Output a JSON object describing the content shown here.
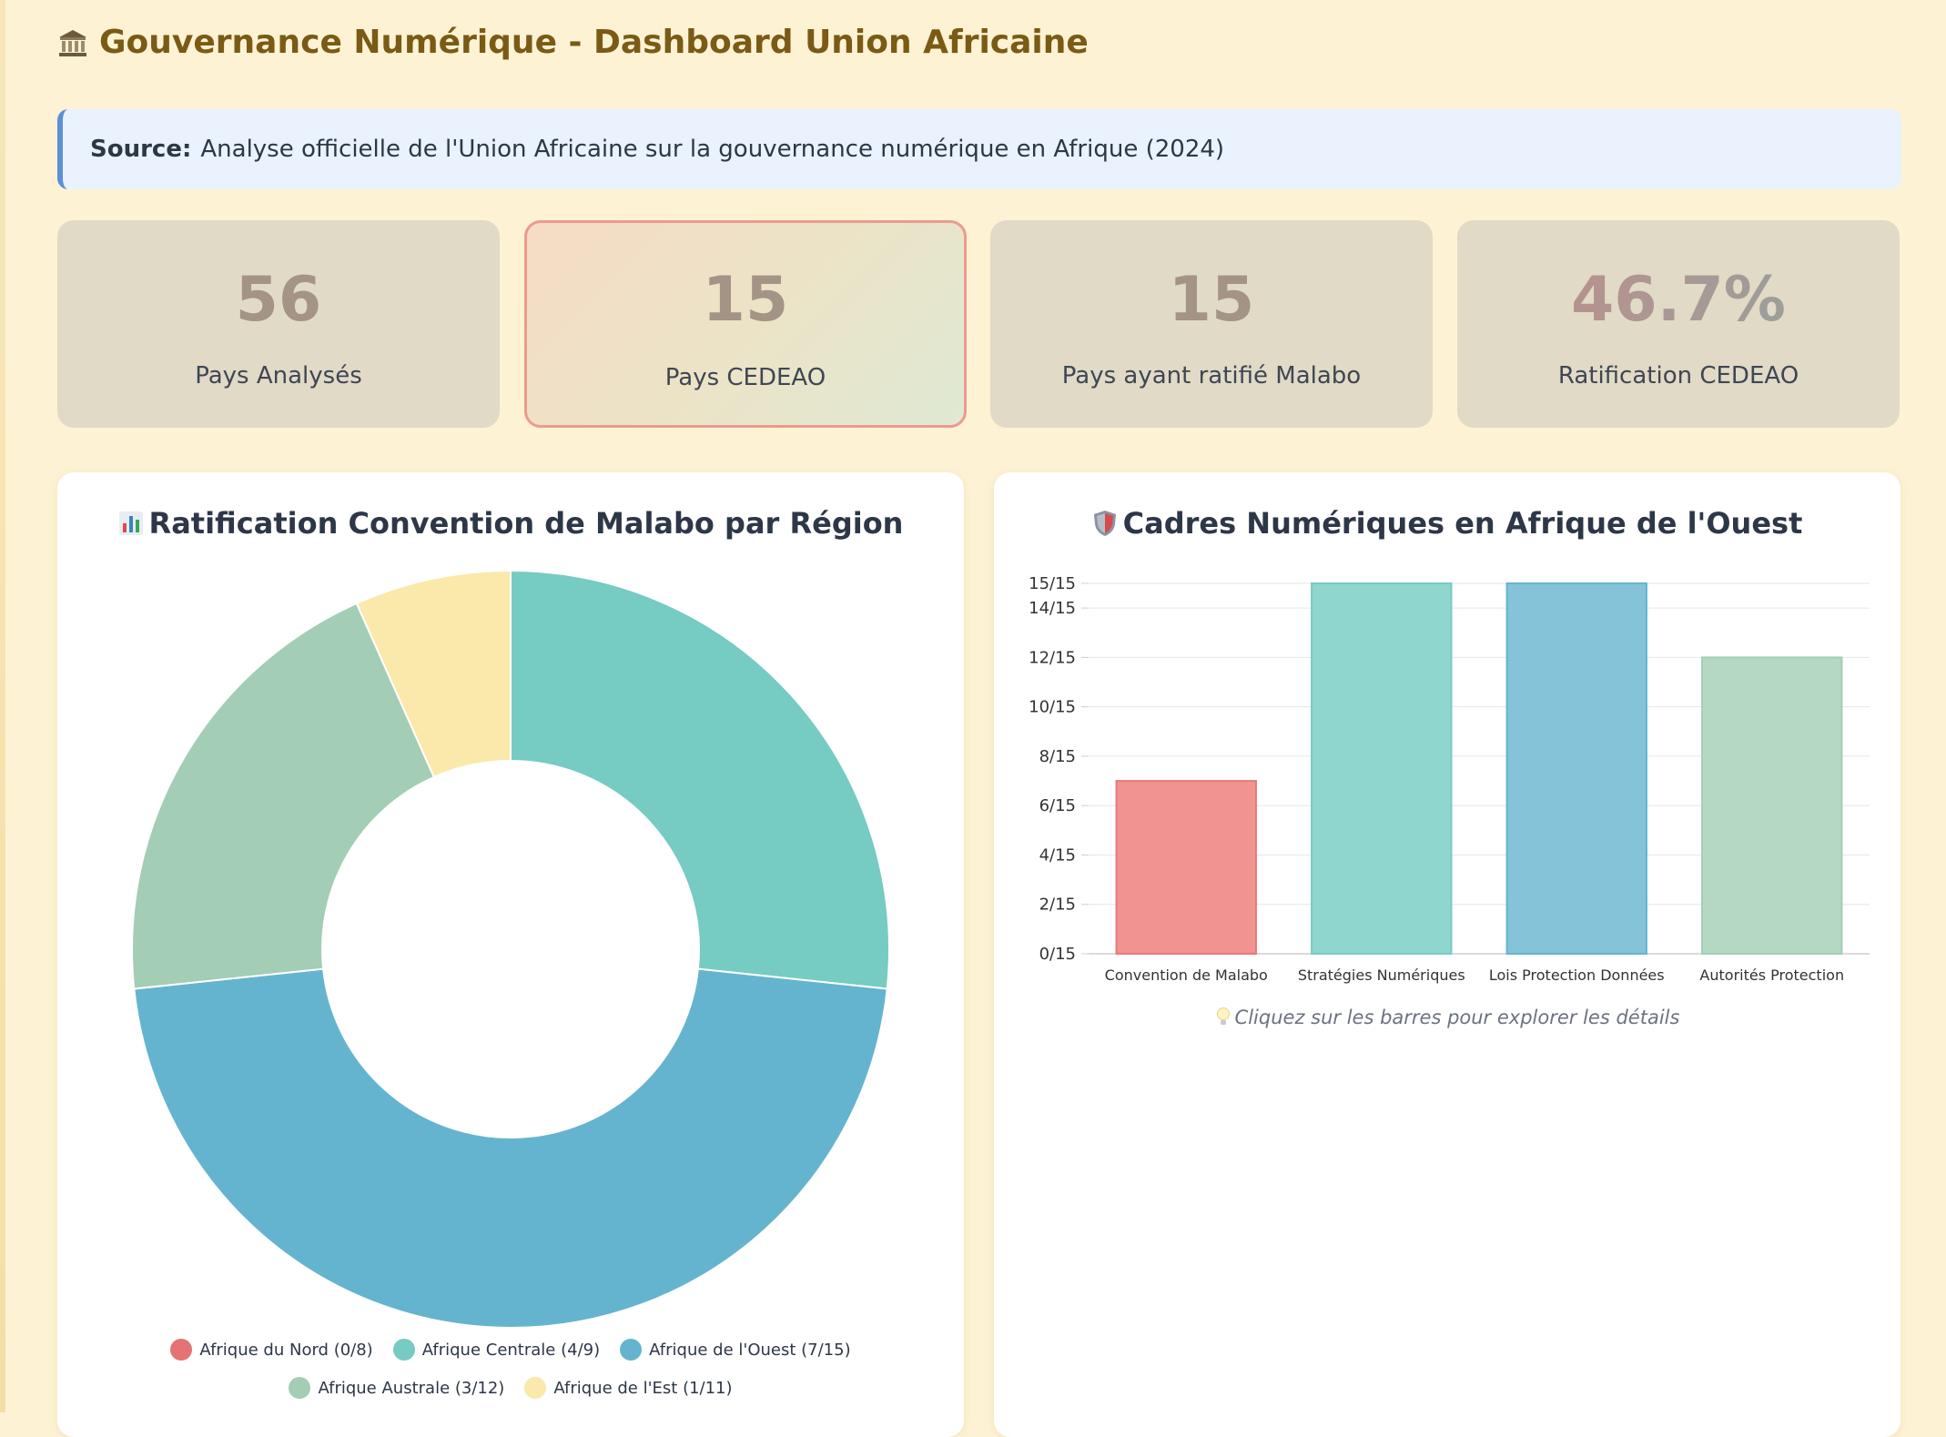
{
  "header": {
    "icon": "bank-icon",
    "title": "Gouvernance Numérique - Dashboard Union Africaine"
  },
  "source": {
    "label": "Source:",
    "text": "Analyse officielle de l'Union Africaine sur la gouvernance numérique en Afrique (2024)"
  },
  "kpis": [
    {
      "value": "56",
      "label": "Pays Analysés"
    },
    {
      "value": "15",
      "label": "Pays CEDEAO"
    },
    {
      "value": "15",
      "label": "Pays ayant ratifié Malabo"
    },
    {
      "value": "46.7%",
      "label": "Ratification CEDEAO"
    }
  ],
  "donut_card": {
    "icon": "bar-chart-icon",
    "title": "Ratification Convention de Malabo par Région"
  },
  "bar_card": {
    "icon": "shield-icon",
    "title": "Cadres Numériques en Afrique de l'Ouest",
    "hint_icon": "lightbulb-icon",
    "hint": "Cliquez sur les barres pour explorer les détails"
  },
  "chart_data": [
    {
      "type": "pie",
      "variant": "doughnut",
      "legend_position": "bottom",
      "categories": [
        "Afrique du Nord (0/8)",
        "Afrique Centrale (4/9)",
        "Afrique de l'Ouest (7/15)",
        "Afrique Australe (3/12)",
        "Afrique de l'Est (1/11)"
      ],
      "values": [
        0,
        4,
        7,
        3,
        1
      ],
      "colors": [
        "#e57373",
        "#76cbc2",
        "#65b4cf",
        "#a3cdb5",
        "#fbe8ab"
      ]
    },
    {
      "type": "bar",
      "categories": [
        "Convention de Malabo",
        "Stratégies Numériques",
        "Lois Protection Données",
        "Autorités Protection"
      ],
      "values": [
        7,
        15,
        15,
        12
      ],
      "colors": [
        "#f19390",
        "#8fd6ce",
        "#84c3d8",
        "#b5d8c3"
      ],
      "border_colors": [
        "#e87979",
        "#76cbc2",
        "#65b4cf",
        "#a3cdb5"
      ],
      "ylim": [
        0,
        15
      ],
      "ytick_values": [
        0,
        2,
        4,
        6,
        8,
        10,
        12,
        14,
        15
      ],
      "ytick_labels": [
        "0/15",
        "2/15",
        "4/15",
        "6/15",
        "8/15",
        "10/15",
        "12/15",
        "14/15",
        "15/15"
      ],
      "grid": true
    }
  ]
}
